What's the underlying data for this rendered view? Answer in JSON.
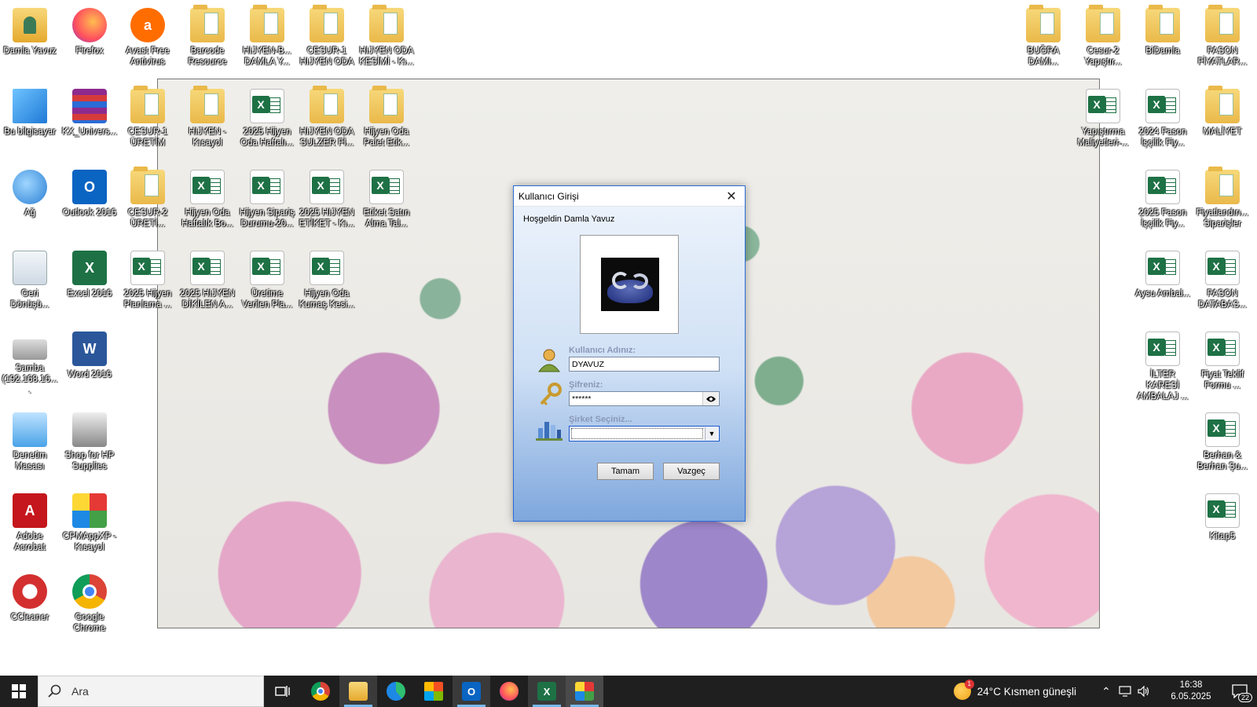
{
  "desktop": {
    "icons_left": [
      {
        "label": "Damla Yavuz",
        "type": "user"
      },
      {
        "label": "Firefox",
        "type": "firefox"
      },
      {
        "label": "Avast Free Antivirus",
        "type": "avast"
      },
      {
        "label": "Barcode Resource",
        "type": "folder"
      },
      {
        "label": "HIJYEN-B... DAMLA Y...",
        "type": "folder"
      },
      {
        "label": "CESUR-1 HIJYEN ODA",
        "type": "folder"
      },
      {
        "label": "HIJYEN ODA KESİMİ - Kı...",
        "type": "folder"
      },
      {
        "label": "Bu bilgisayar",
        "type": "pc"
      },
      {
        "label": "KX_Univers...",
        "type": "winrar"
      },
      {
        "label": "CESUR-1 ÜRETİM",
        "type": "folder"
      },
      {
        "label": "HIJYEN - Kısayol",
        "type": "folder"
      },
      {
        "label": "2025 Hijyen Oda Haftalı...",
        "type": "excel"
      },
      {
        "label": "HIJYEN ODA SULZER Fİ...",
        "type": "folder"
      },
      {
        "label": "Hijyen Oda Palet Etik...",
        "type": "folder"
      },
      {
        "label": "Ağ",
        "type": "network"
      },
      {
        "label": "Outlook 2016",
        "type": "outlook"
      },
      {
        "label": "CESUR-2 ÜRETİ...",
        "type": "folder"
      },
      {
        "label": "Hijyen Oda Haftalık Bo...",
        "type": "excel"
      },
      {
        "label": "Hijyen Sipariş Durumu-20...",
        "type": "excel"
      },
      {
        "label": "2025 HIJYEN ETİKET - Kı...",
        "type": "excel"
      },
      {
        "label": "Etiket Satın Alma Tal...",
        "type": "excel"
      },
      {
        "label": "Geri Dönüşü...",
        "type": "recycle"
      },
      {
        "label": "Excel 2016",
        "type": "excelapp"
      },
      {
        "label": "2025 Hijyen Planlama ...",
        "type": "excel"
      },
      {
        "label": "2025 HIJYEN DİKİLEN A...",
        "type": "excel"
      },
      {
        "label": "Üretime Verilen Pla...",
        "type": "excel"
      },
      {
        "label": "Hijyen Oda Kumaş Kesi...",
        "type": "excel"
      },
      {
        "label": "Samba (192.168.16....",
        "type": "drive"
      },
      {
        "label": "Word 2016",
        "type": "word"
      },
      {
        "label": "Denetim Masası",
        "type": "control"
      },
      {
        "label": "Shop for HP Supplies",
        "type": "hp"
      },
      {
        "label": "Adobe Acrobat",
        "type": "acrobat"
      },
      {
        "label": "CPMAppXP - Kısayol",
        "type": "puzzle"
      },
      {
        "label": "CCleaner",
        "type": "ccleaner"
      },
      {
        "label": "Google Chrome",
        "type": "chrome"
      }
    ],
    "icons_right": [
      {
        "label": "BUĞRA DAMI...",
        "type": "folder"
      },
      {
        "label": "Cesur-2 Yapıştır...",
        "type": "folder"
      },
      {
        "label": "BiDamla",
        "type": "folder"
      },
      {
        "label": "FASON FİYATLAR...",
        "type": "folder"
      },
      {
        "label": "Yapıştırma Maliyetleri-...",
        "type": "excel"
      },
      {
        "label": "2024 Fason İşçilik Fiy...",
        "type": "excel"
      },
      {
        "label": "MALİYET",
        "type": "folder"
      },
      {
        "label": "2025 Fason İşçilik Fiy...",
        "type": "excel"
      },
      {
        "label": "Fiyatlandırı... Siparişler",
        "type": "folder"
      },
      {
        "label": "Aysu Ambal...",
        "type": "excel"
      },
      {
        "label": "FASON DATABAS...",
        "type": "excel"
      },
      {
        "label": "İLTER KARESİ AMBALAJ ...",
        "type": "excel"
      },
      {
        "label": "Fiyat Teklif Formu ...",
        "type": "excel"
      },
      {
        "label": "Berhan & Berhan Şu...",
        "type": "excel"
      },
      {
        "label": "Kitap5",
        "type": "excel"
      }
    ]
  },
  "dialog": {
    "title": "Kullanıcı Girişi",
    "welcome": "Hoşgeldin Damla Yavuz",
    "username_label": "Kullanıcı Adınız:",
    "username_value": "DYAVUZ",
    "password_label": "Şifreniz:",
    "password_value": "******",
    "company_label": "Şirket Seçiniz...",
    "company_value": "",
    "ok_label": "Tamam",
    "cancel_label": "Vazgeç",
    "close_glyph": "✕"
  },
  "taskbar": {
    "search_placeholder": "Ara",
    "weather": "24°C  Kısmen güneşli",
    "weather_badge": "1",
    "time": "16:38",
    "date": "6.05.2025",
    "notification_count": "22",
    "apps": [
      "task-view",
      "chrome",
      "file-explorer",
      "edge",
      "store",
      "outlook",
      "firefox",
      "excel",
      "cpm-app"
    ]
  },
  "colors": {
    "dialog_border": "#2b6cd4",
    "taskbar_bg": "#1f1f1f",
    "excel_green": "#1e7145",
    "label_gray": "#8a98b8"
  }
}
